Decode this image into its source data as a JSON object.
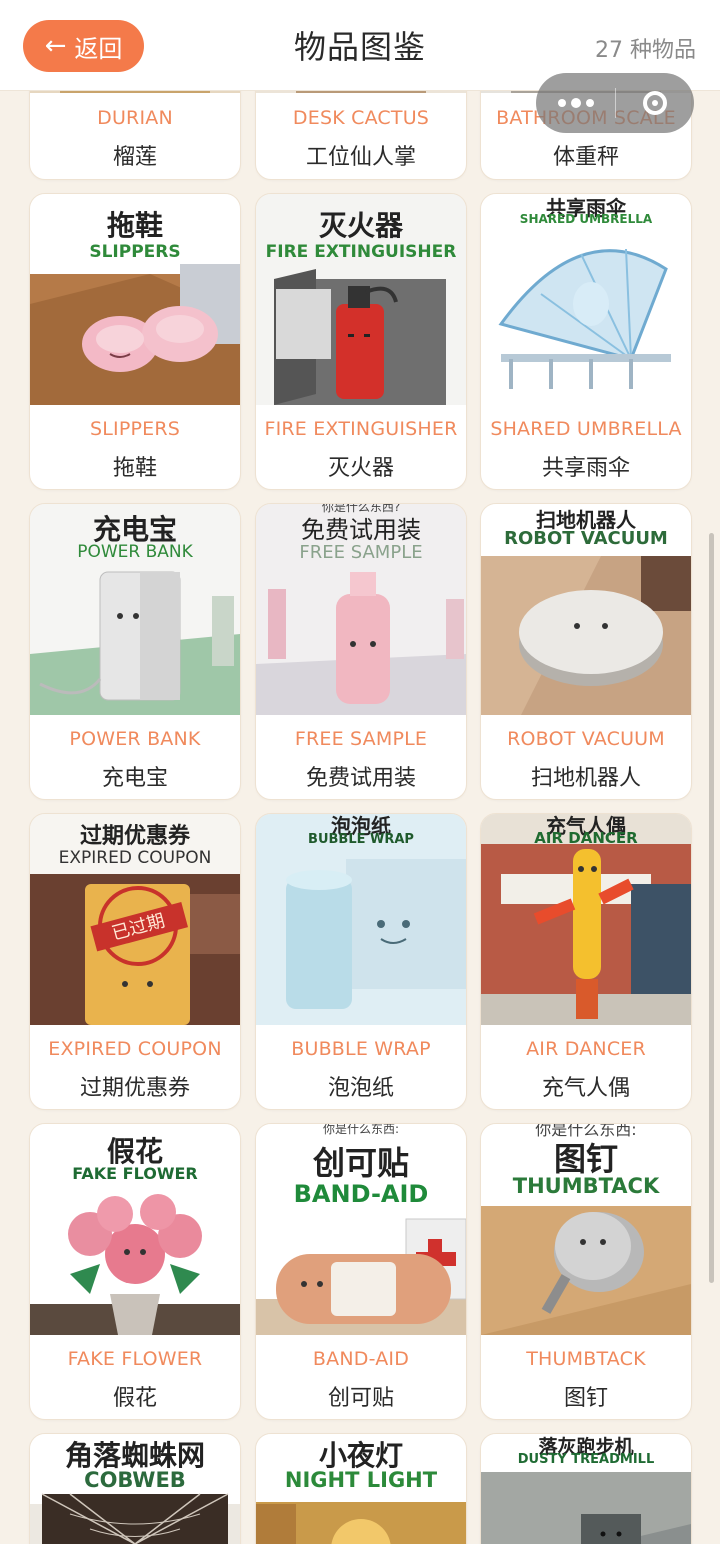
{
  "header": {
    "back_label": "返回",
    "title": "物品图鉴",
    "count": "27 种物品"
  },
  "colors": {
    "accent": "#f47a4a",
    "label_en": "#f08a5d",
    "bg": "#f7f1e8",
    "art_en_green": "#2f8a3a"
  },
  "items": [
    {
      "en": "DURIAN",
      "zh": "榴莲"
    },
    {
      "en": "DESK CACTUS",
      "zh": "工位仙人掌"
    },
    {
      "en": "BATHROOM SCALE",
      "zh": "体重秤"
    },
    {
      "en": "SLIPPERS",
      "zh": "拖鞋",
      "art_zh": "拖鞋",
      "art_en": "SLIPPERS"
    },
    {
      "en": "FIRE EXTINGUISHER",
      "zh": "灭火器",
      "art_zh": "灭火器",
      "art_en": "FIRE EXTINGUISHER"
    },
    {
      "en": "SHARED UMBRELLA",
      "zh": "共享雨伞",
      "art_zh": "共享雨伞",
      "art_en": "SHARED UMBRELLA"
    },
    {
      "en": "POWER BANK",
      "zh": "充电宝",
      "art_zh": "充电宝",
      "art_en": "POWER BANK"
    },
    {
      "en": "FREE SAMPLE",
      "zh": "免费试用装",
      "art_top": "你是什么东西?",
      "art_zh": "免费试用装",
      "art_en": "FREE SAMPLE"
    },
    {
      "en": "ROBOT VACUUM",
      "zh": "扫地机器人",
      "art_zh": "扫地机器人",
      "art_en": "ROBOT VACUUM"
    },
    {
      "en": "EXPIRED COUPON",
      "zh": "过期优惠券",
      "art_zh": "过期优惠券",
      "art_en": "EXPIRED COUPON",
      "stamp": "已过期"
    },
    {
      "en": "BUBBLE WRAP",
      "zh": "泡泡纸",
      "art_zh": "泡泡纸",
      "art_en": "BUBBLE WRAP"
    },
    {
      "en": "AIR DANCER",
      "zh": "充气人偶",
      "art_zh": "充气人偶",
      "art_en": "AIR DANCER"
    },
    {
      "en": "FAKE FLOWER",
      "zh": "假花",
      "art_zh": "假花",
      "art_en": "FAKE FLOWER"
    },
    {
      "en": "BAND-AID",
      "zh": "创可贴",
      "art_top": "你是什么东西:",
      "art_zh": "创可贴",
      "art_en": "BAND-AID"
    },
    {
      "en": "THUMBTACK",
      "zh": "图钉",
      "art_top": "你是什么东西:",
      "art_zh": "图钉",
      "art_en": "THUMBTACK"
    },
    {
      "art_zh": "角落蜘蛛网",
      "art_en": "COBWEB"
    },
    {
      "art_zh": "小夜灯",
      "art_en": "NIGHT LIGHT"
    },
    {
      "art_zh": "落灰跑步机",
      "art_en": "DUSTY TREADMILL"
    }
  ]
}
